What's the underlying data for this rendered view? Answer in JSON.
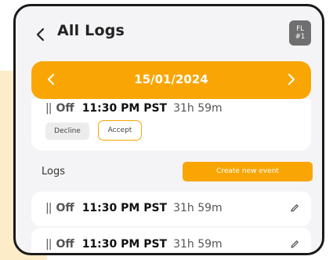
{
  "header": {
    "title": "All Logs",
    "avatar_line1": "FL",
    "avatar_line2": "#1"
  },
  "date_bar": {
    "date": "15/01/2024"
  },
  "pending": {
    "status": "Off",
    "time": "11:30 PM PST",
    "duration": "31h 59m",
    "decline_label": "Decline",
    "accept_label": "Accept"
  },
  "logs": {
    "label": "Logs",
    "create_label": "Create new event",
    "items": [
      {
        "status": "Off",
        "time": "11:30 PM PST",
        "duration": "31h 59m"
      },
      {
        "status": "Off",
        "time": "11:30 PM PST",
        "duration": "31h 59m"
      }
    ]
  },
  "colors": {
    "accent": "#f9a605",
    "background": "#f4f4f6",
    "card": "#ffffff"
  },
  "icons": [
    "chevron-left-icon",
    "chevron-right-icon",
    "pause-icon",
    "pencil-icon"
  ]
}
